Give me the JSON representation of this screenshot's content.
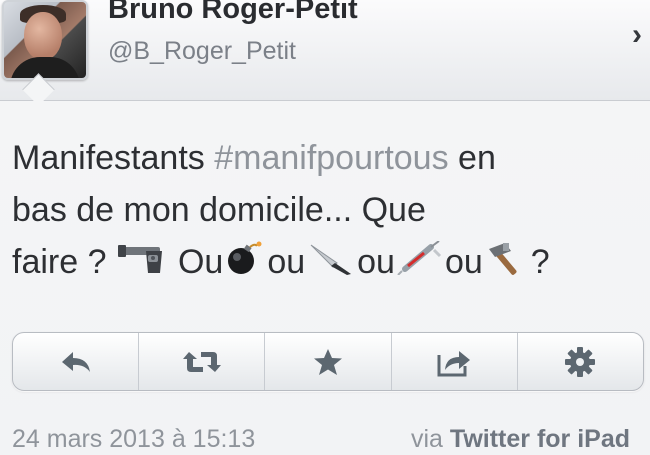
{
  "profile": {
    "name": "Bruno Roger-Petit",
    "handle": "@B_Roger_Petit"
  },
  "tweet": {
    "line1_prefix": "Manifestants ",
    "hashtag": "#manifpourtous",
    "line1_suffix": " en",
    "line2": "bas de mon domicile... Que",
    "line3_start": "faire ? ",
    "ou_1": "Ou",
    "ou_2": "ou",
    "ou_3": "ou",
    "ou_4": "ou",
    "end": "?"
  },
  "emojis": [
    "pistol-emoji",
    "bomb-emoji",
    "knife-emoji",
    "syringe-emoji",
    "hammer-emoji"
  ],
  "toolbar": {
    "icons": [
      "reply-icon",
      "retweet-icon",
      "favorite-star-icon",
      "share-icon",
      "gear-icon"
    ]
  },
  "footer": {
    "timestamp": "24 mars 2013 à 15:13",
    "via_prefix": "via ",
    "client": "Twitter for iPad"
  },
  "colors": {
    "text": "#2d2f33",
    "hashtag": "#8f949b",
    "icon": "#5c6770"
  }
}
